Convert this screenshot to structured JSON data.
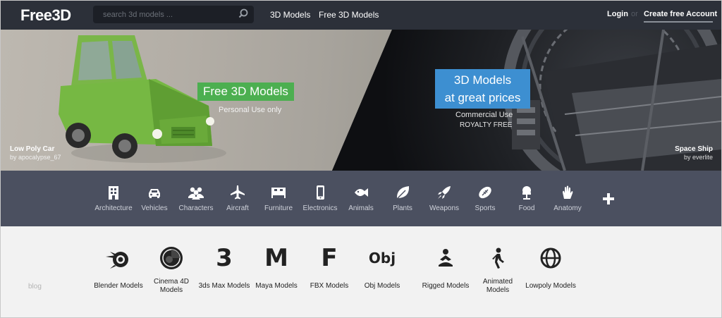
{
  "header": {
    "logo": "Free3D",
    "search_placeholder": "search 3d models ...",
    "nav": [
      "3D Models",
      "Free 3D Models"
    ],
    "login": "Login",
    "or": "or",
    "create_account": "Create free Account"
  },
  "hero": {
    "left_title": "Free 3D Models",
    "left_sub": "Personal Use only",
    "right_title_1": "3D Models",
    "right_title_2": "at great prices",
    "right_sub_1": "Commercial Use",
    "right_sub_2": "ROYALTY FREE",
    "left_credit_title": "Low Poly Car",
    "left_credit_author": "by apocalypse_67",
    "right_credit_title": "Space Ship",
    "right_credit_author": "by everlite",
    "colors": {
      "green_tag": "#4caf50",
      "blue_tag": "#3d8fd1"
    }
  },
  "categories": [
    {
      "label": "Architecture",
      "icon": "building-icon"
    },
    {
      "label": "Vehicles",
      "icon": "car-icon"
    },
    {
      "label": "Characters",
      "icon": "people-icon"
    },
    {
      "label": "Aircraft",
      "icon": "airplane-icon"
    },
    {
      "label": "Furniture",
      "icon": "bed-icon"
    },
    {
      "label": "Electronics",
      "icon": "phone-icon"
    },
    {
      "label": "Animals",
      "icon": "fish-icon"
    },
    {
      "label": "Plants",
      "icon": "leaf-icon"
    },
    {
      "label": "Weapons",
      "icon": "rocket-icon"
    },
    {
      "label": "Sports",
      "icon": "football-icon"
    },
    {
      "label": "Food",
      "icon": "food-icon"
    },
    {
      "label": "Anatomy",
      "icon": "hand-icon"
    }
  ],
  "formats": [
    {
      "label": "Blender Models",
      "icon": "blender-icon"
    },
    {
      "label": "Cinema 4D\nModels",
      "icon": "cinema4d-icon"
    },
    {
      "label": "3ds Max Models",
      "icon": "3dsmax-icon",
      "glyph": "3"
    },
    {
      "label": "Maya Models",
      "icon": "maya-icon",
      "glyph": "M"
    },
    {
      "label": "FBX Models",
      "icon": "fbx-icon",
      "glyph": "F"
    },
    {
      "label": "Obj Models",
      "icon": "obj-icon",
      "glyph": "Obj"
    },
    {
      "label": "Rigged Models",
      "icon": "rigged-icon"
    },
    {
      "label": "Animated\nModels",
      "icon": "walking-icon"
    },
    {
      "label": "Lowpoly Models",
      "icon": "globe-icon"
    }
  ],
  "blog": "blog"
}
